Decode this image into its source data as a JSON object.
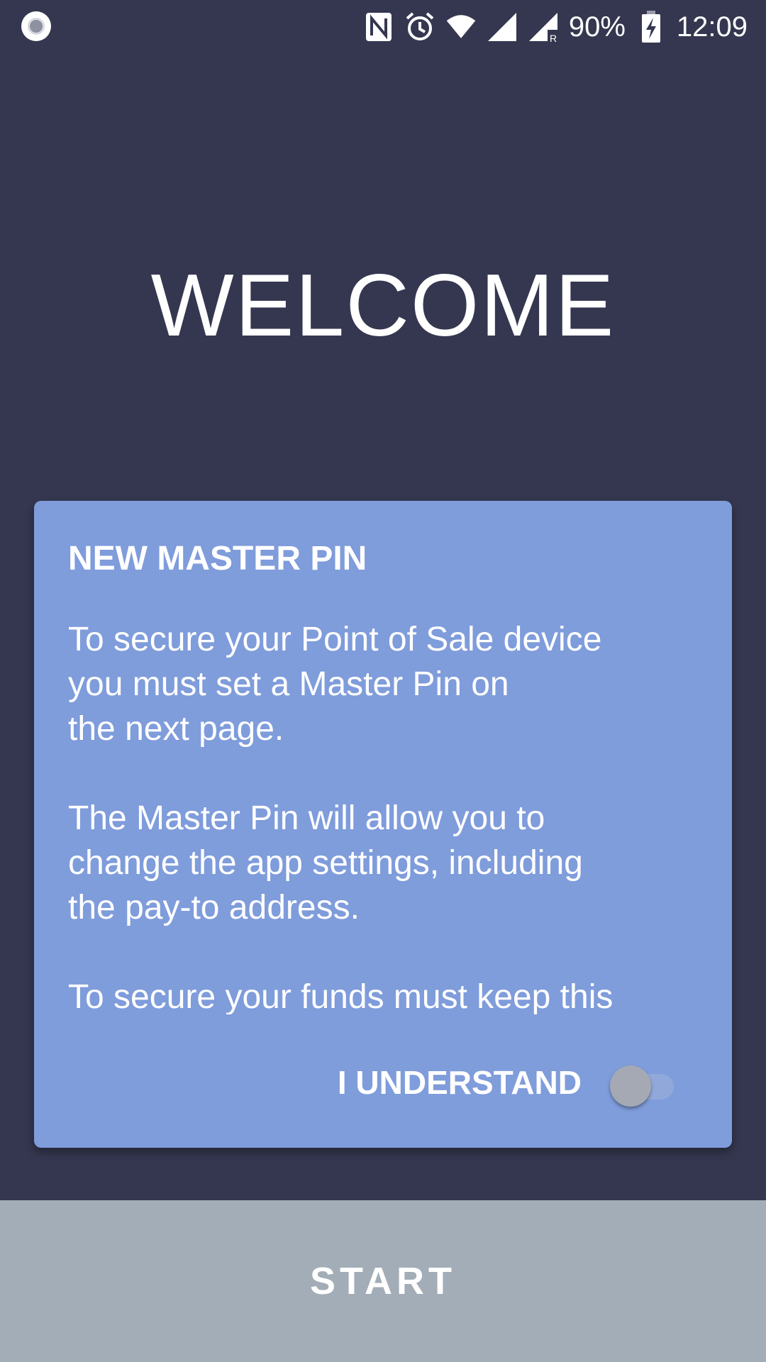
{
  "status_bar": {
    "battery_text": "90%",
    "time": "12:09",
    "icons": [
      "record-icon",
      "nfc-icon",
      "alarm-icon",
      "wifi-icon",
      "signal-icon",
      "signal-roaming-icon",
      "battery-charging-icon"
    ]
  },
  "title": "WELCOME",
  "card": {
    "title": "NEW MASTER PIN",
    "paragraphs": [
      "To secure your Point of Sale device\nyou must set a Master Pin on\nthe next page.",
      "The Master Pin will allow you to\nchange the app settings, including\nthe pay-to address.",
      "To secure your funds must keep this"
    ],
    "understand_label": "I UNDERSTAND",
    "understand_checked": false
  },
  "start_button": {
    "label": "START"
  },
  "colors": {
    "background": "#34374f",
    "card": "#7f9cdb",
    "start_button": "#a3adb7"
  }
}
